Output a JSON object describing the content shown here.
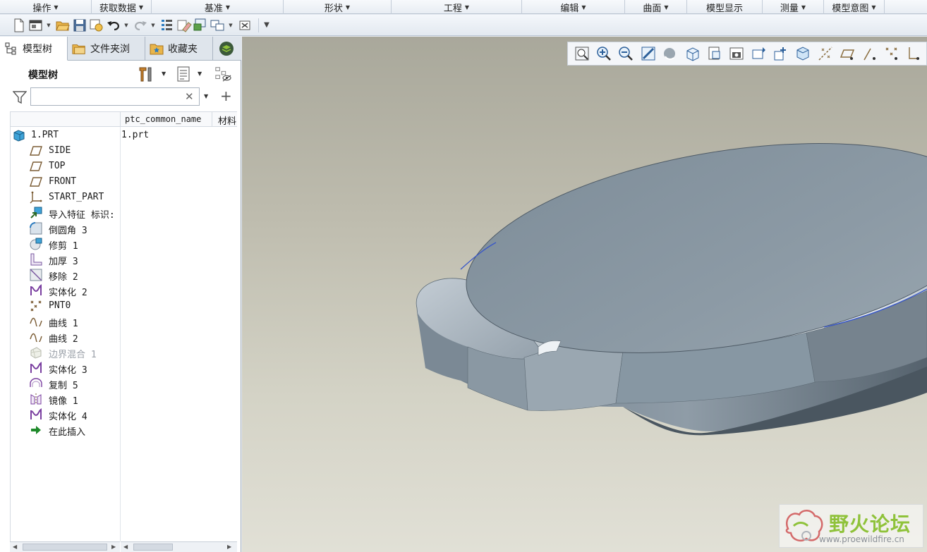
{
  "ribbon": {
    "groups": [
      {
        "label": "操作"
      },
      {
        "label": "获取数据"
      },
      {
        "label": "基准"
      },
      {
        "label": "形状"
      },
      {
        "label": "工程"
      },
      {
        "label": "编辑"
      },
      {
        "label": "曲面"
      },
      {
        "label": "模型显示"
      },
      {
        "label": "测量"
      },
      {
        "label": "模型意图"
      }
    ]
  },
  "panel": {
    "tabs": [
      {
        "label": "模型树",
        "icon": "model-tree-icon"
      },
      {
        "label": "文件夹浏",
        "icon": "folder-icon"
      },
      {
        "label": "收藏夹",
        "icon": "favorites-icon"
      }
    ],
    "title": "模型树",
    "search_value": "",
    "columns": [
      "ptc_common_name",
      "材料"
    ],
    "tree": [
      {
        "label": "1.PRT",
        "value": "1.prt",
        "icon": "part-icon",
        "root": true
      },
      {
        "label": "SIDE",
        "icon": "datum-plane-icon"
      },
      {
        "label": "TOP",
        "icon": "datum-plane-icon"
      },
      {
        "label": "FRONT",
        "icon": "datum-plane-icon"
      },
      {
        "label": "START_PART",
        "icon": "coordinate-system-icon"
      },
      {
        "label": "导入特征 标识:",
        "icon": "import-feature-icon"
      },
      {
        "label": "倒圆角 3",
        "icon": "round-icon"
      },
      {
        "label": "修剪 1",
        "icon": "trim-icon"
      },
      {
        "label": "加厚 3",
        "icon": "thicken-icon"
      },
      {
        "label": "移除 2",
        "icon": "remove-icon"
      },
      {
        "label": "实体化 2",
        "icon": "solidify-icon"
      },
      {
        "label": "PNT0",
        "icon": "datum-point-icon"
      },
      {
        "label": "曲线 1",
        "icon": "curve-icon"
      },
      {
        "label": "曲线 2",
        "icon": "curve-icon"
      },
      {
        "label": "边界混合 1",
        "icon": "boundary-blend-icon",
        "dim": true
      },
      {
        "label": "实体化 3",
        "icon": "solidify-icon"
      },
      {
        "label": "复制 5",
        "icon": "copy-icon"
      },
      {
        "label": "镜像 1",
        "icon": "mirror-icon"
      },
      {
        "label": "实体化 4",
        "icon": "solidify-icon"
      },
      {
        "label": "在此插入",
        "icon": "insert-here-icon"
      }
    ]
  },
  "watermark": {
    "text": "野火论坛",
    "url": "www.proewildfire.cn"
  },
  "colors": {
    "accent": "#2b7bbf",
    "model_surface": "#8c9aa5",
    "watermark_green": "#8fc23a"
  }
}
